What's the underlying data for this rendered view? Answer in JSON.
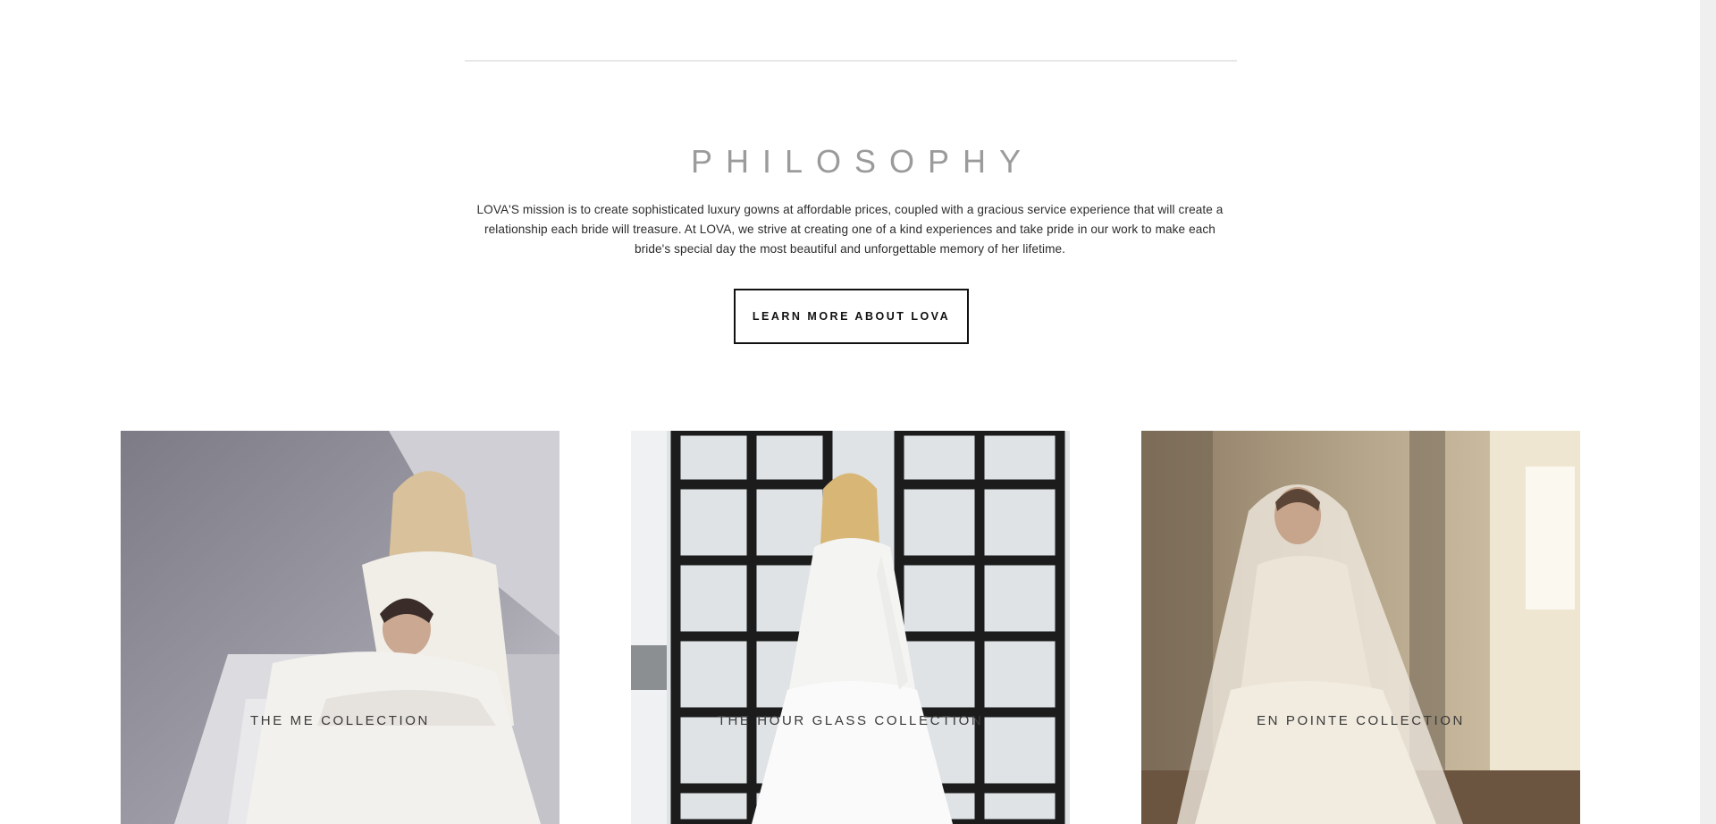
{
  "philosophy": {
    "heading": "PHILOSOPHY",
    "mission_text": "LOVA'S mission is to create sophisticated luxury gowns at affordable prices, coupled with a gracious service experience that will create a relationship each bride will treasure. At LOVA, we strive at creating one of a kind experiences and take pride in our work to make each bride's special day the most beautiful and unforgettable memory of her lifetime.",
    "button_label": "LEARN MORE ABOUT LOVA"
  },
  "collections": [
    {
      "label": "THE ME COLLECTION"
    },
    {
      "label": "THE HOUR GLASS COLLECTION"
    },
    {
      "label": "EN POINTE COLLECTION"
    }
  ],
  "colors": {
    "heading_gray": "#9b9b9b",
    "text_dark": "#2b2b2b",
    "button_border": "#111111"
  }
}
